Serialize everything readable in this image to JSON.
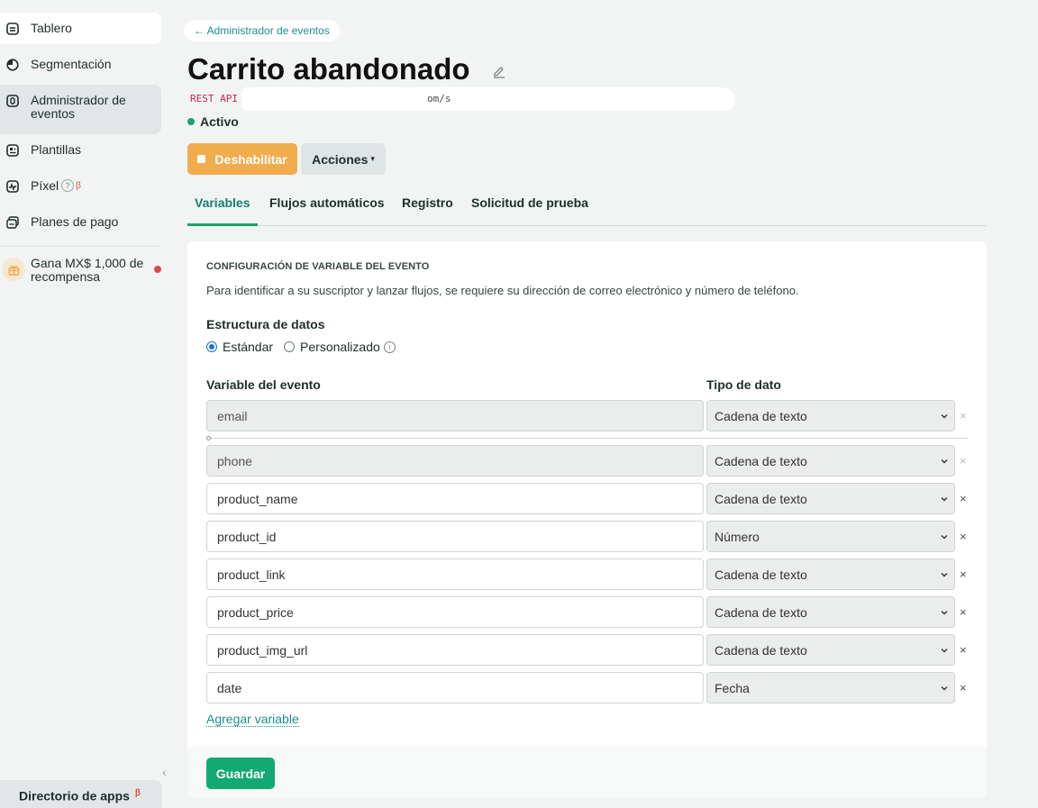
{
  "sidebar": {
    "items": [
      {
        "label": "Tablero",
        "icon": "dashboard-icon"
      },
      {
        "label": "Segmentación",
        "icon": "segment-pie-icon"
      },
      {
        "label": "Administrador de eventos",
        "icon": "event-manager-icon"
      },
      {
        "label": "Plantillas",
        "icon": "templates-icon"
      },
      {
        "label": "Píxel",
        "icon": "pixel-icon",
        "help": "?",
        "beta": "β"
      },
      {
        "label": "Planes de pago",
        "icon": "payment-plans-icon"
      }
    ],
    "reward": {
      "label": "Gana MX$ 1,000 de recompensa",
      "icon": "gift-icon"
    },
    "collapse": "‹",
    "app_directory": {
      "label": "Directorio de apps",
      "beta": "β"
    }
  },
  "header": {
    "back_link": "← Administrador de eventos",
    "title": "Carrito abandonado",
    "api_tag": "REST API",
    "api_url": "om/s",
    "status": "Activo"
  },
  "actions": {
    "disable": "Deshabilitar",
    "more": "Acciones",
    "caret": "▾"
  },
  "tabs": [
    {
      "label": "Variables",
      "active": true
    },
    {
      "label": "Flujos automáticos",
      "active": false
    },
    {
      "label": "Registro",
      "active": false
    },
    {
      "label": "Solicitud de prueba",
      "active": false
    }
  ],
  "config": {
    "heading": "CONFIGURACIÓN DE VARIABLE DEL EVENTO",
    "description": "Para identificar a su suscriptor y lanzar flujos, se requiere su dirección de correo electrónico y número de teléfono.",
    "structure_label": "Estructura de datos",
    "options": [
      {
        "label": "Estándar",
        "selected": true
      },
      {
        "label": "Personalizado",
        "selected": false
      }
    ],
    "info": "i",
    "col_variable": "Variable del evento",
    "col_type": "Tipo de dato",
    "remove": "×",
    "rows": [
      {
        "variable": "email",
        "type": "Cadena de texto",
        "locked": true
      },
      {
        "variable": "phone",
        "type": "Cadena de texto",
        "locked": true
      },
      {
        "variable": "product_name",
        "type": "Cadena de texto",
        "locked": false
      },
      {
        "variable": "product_id",
        "type": "Número",
        "locked": false
      },
      {
        "variable": "product_link",
        "type": "Cadena de texto",
        "locked": false
      },
      {
        "variable": "product_price",
        "type": "Cadena de texto",
        "locked": false
      },
      {
        "variable": "product_img_url",
        "type": "Cadena de texto",
        "locked": false
      },
      {
        "variable": "date",
        "type": "Fecha",
        "locked": false
      }
    ],
    "add_variable": "Agregar variable",
    "save": "Guardar"
  },
  "colors": {
    "accent_green": "#16a56e",
    "warning_orange": "#f1ac4e",
    "link_teal": "#1a8f86"
  }
}
